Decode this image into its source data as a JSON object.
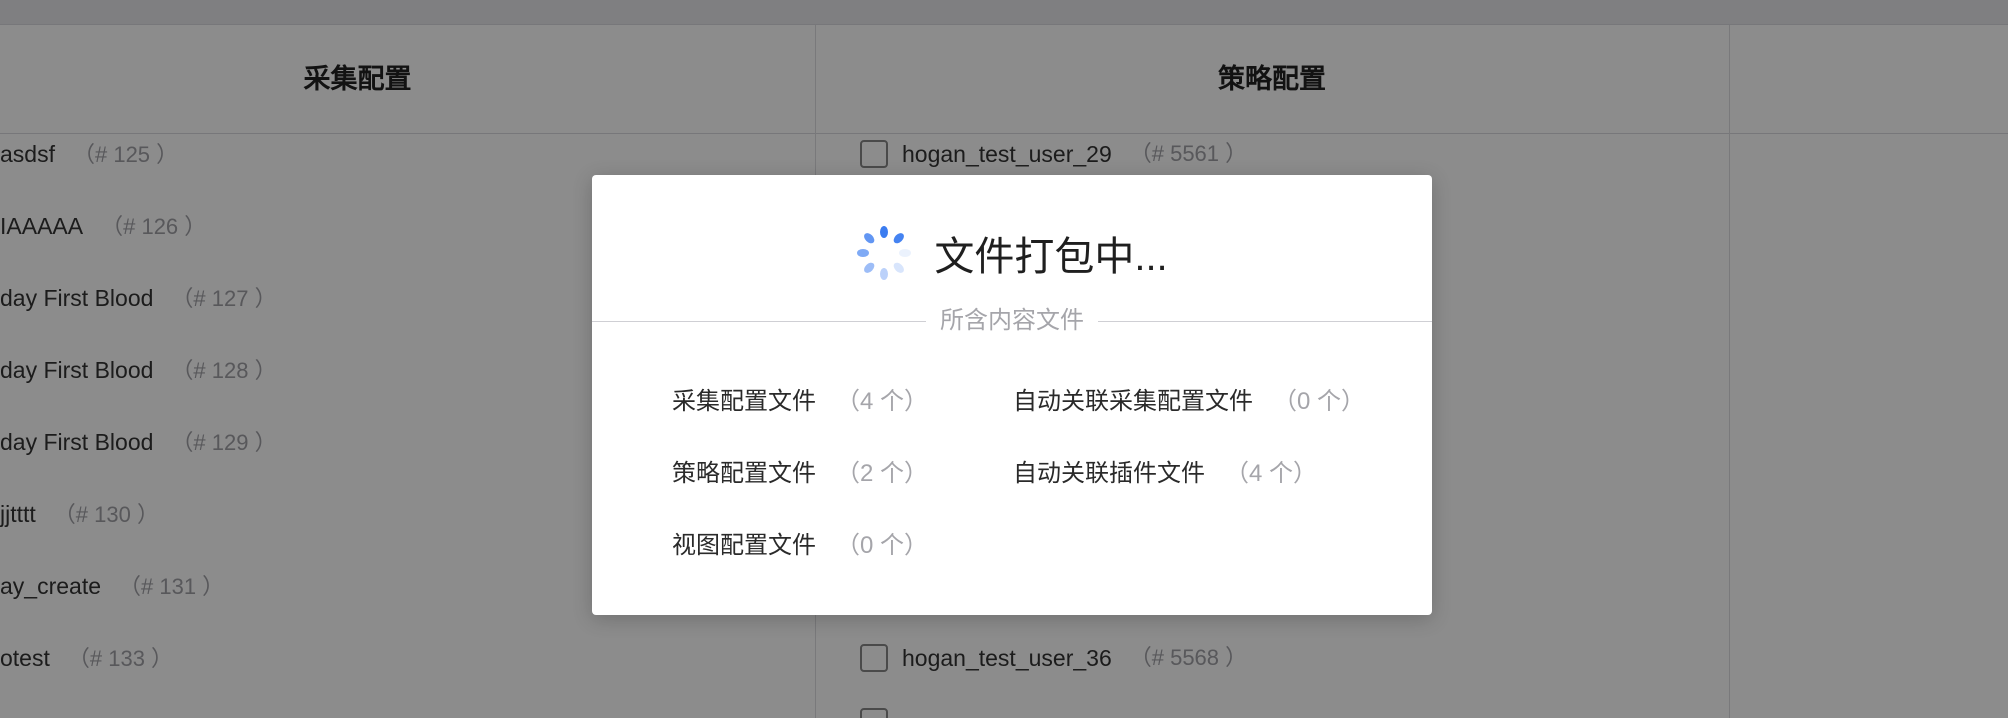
{
  "columns": {
    "collect": "采集配置",
    "strategy": "策略配置"
  },
  "left_rows": [
    {
      "name": "asdsf",
      "id": "（# 125 ）"
    },
    {
      "name": "IAAAAA",
      "id": "（# 126 ）"
    },
    {
      "name": "day First Blood",
      "id": "（# 127 ）"
    },
    {
      "name": "day First Blood",
      "id": "（# 128 ）"
    },
    {
      "name": "day First Blood",
      "id": "（# 129 ）"
    },
    {
      "name": "jjtttt",
      "id": "（# 130 ）"
    },
    {
      "name": "ay_create",
      "id": "（# 131 ）"
    },
    {
      "name": "otest",
      "id": "（# 133 ）"
    }
  ],
  "right_rows": [
    {
      "name": "hogan_test_user_29",
      "id": "（# 5561 ）"
    },
    {
      "name": "hogan_test_user_36",
      "id": "（# 5568 ）"
    }
  ],
  "modal": {
    "title": "文件打包中...",
    "divider_label": "所含内容文件",
    "items": [
      {
        "label": "采集配置文件",
        "count": "（4 个）"
      },
      {
        "label": "自动关联采集配置文件",
        "count": "（0 个）"
      },
      {
        "label": "策略配置文件",
        "count": "（2 个）"
      },
      {
        "label": "自动关联插件文件",
        "count": "（4 个）"
      },
      {
        "label": "视图配置文件",
        "count": "（0 个）"
      }
    ],
    "spinner_color": "#3b7cf0"
  }
}
